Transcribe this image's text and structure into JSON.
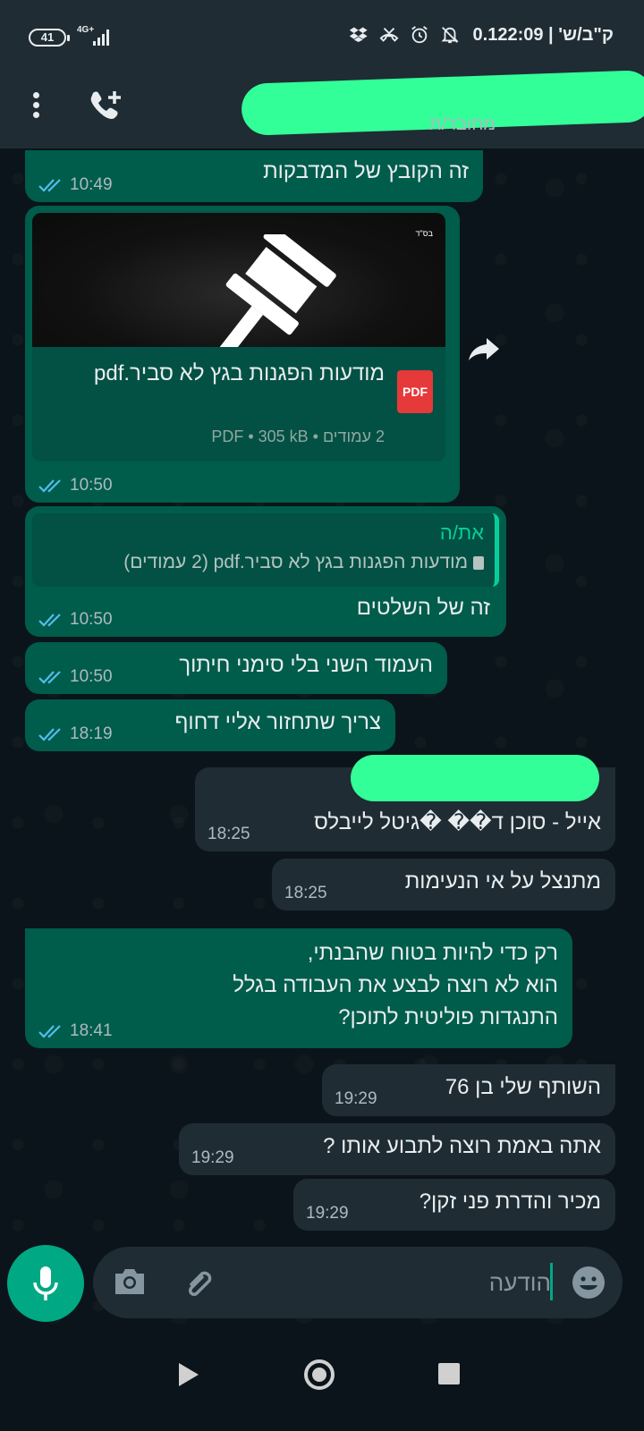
{
  "status_bar": {
    "battery": "41",
    "network": "4G+",
    "right_text": "0.1ק\"ב/ש' | 22:09"
  },
  "header": {
    "contact_status": "מחובר/ת"
  },
  "messages": [
    {
      "text": "זה הקובץ של המדבקות",
      "time": "10:49"
    },
    {
      "doc_name": "מודעות הפגנות בגץ לא סביר.pdf",
      "doc_meta": "2 עמודים • PDF • 305 kB",
      "doc_icon_label": "PDF",
      "thumb_label": "בס\"ד",
      "time": "10:50"
    },
    {
      "quote_author": "את/ה",
      "quote_text": "מודעות הפגנות בגץ לא סביר.pdf (2 עמודים)",
      "text": "זה של השלטים",
      "time": "10:50"
    },
    {
      "text": "העמוד השני בלי סימני חיתוך",
      "time": "10:50"
    },
    {
      "text": "צריך שתחזור אליי דחוף",
      "time": "18:19"
    },
    {
      "text": "אייל - סוכן ד�� �גיטל לייבלס",
      "time": "18:25"
    },
    {
      "text": "מתנצל על אי הנעימות",
      "time": "18:25"
    },
    {
      "text": "רק כדי להיות בטוח שהבנתי,\nהוא לא רוצה לבצע את העבודה בגלל\nהתנגדות פוליטית לתוכן?",
      "time": "18:41"
    },
    {
      "text": "השותף שלי בן 76",
      "time": "19:29"
    },
    {
      "text": "אתה באמת רוצה לתבוע אותו ?",
      "time": "19:29"
    },
    {
      "text": "מכיר והדרת פני זקן?",
      "time": "19:29"
    }
  ],
  "input": {
    "placeholder": "הודעה"
  },
  "colors": {
    "outgoing_bubble": "#005c4b",
    "incoming_bubble": "#1f2c34",
    "accent": "#00a884",
    "read_ticks": "#53bdeb",
    "redaction": "#33ff99"
  },
  "icons": [
    "menu-icon",
    "add-call-icon",
    "forward-icon",
    "mic-icon",
    "camera-icon",
    "attach-icon",
    "emoji-icon",
    "pdf-icon",
    "gavel-icon"
  ]
}
